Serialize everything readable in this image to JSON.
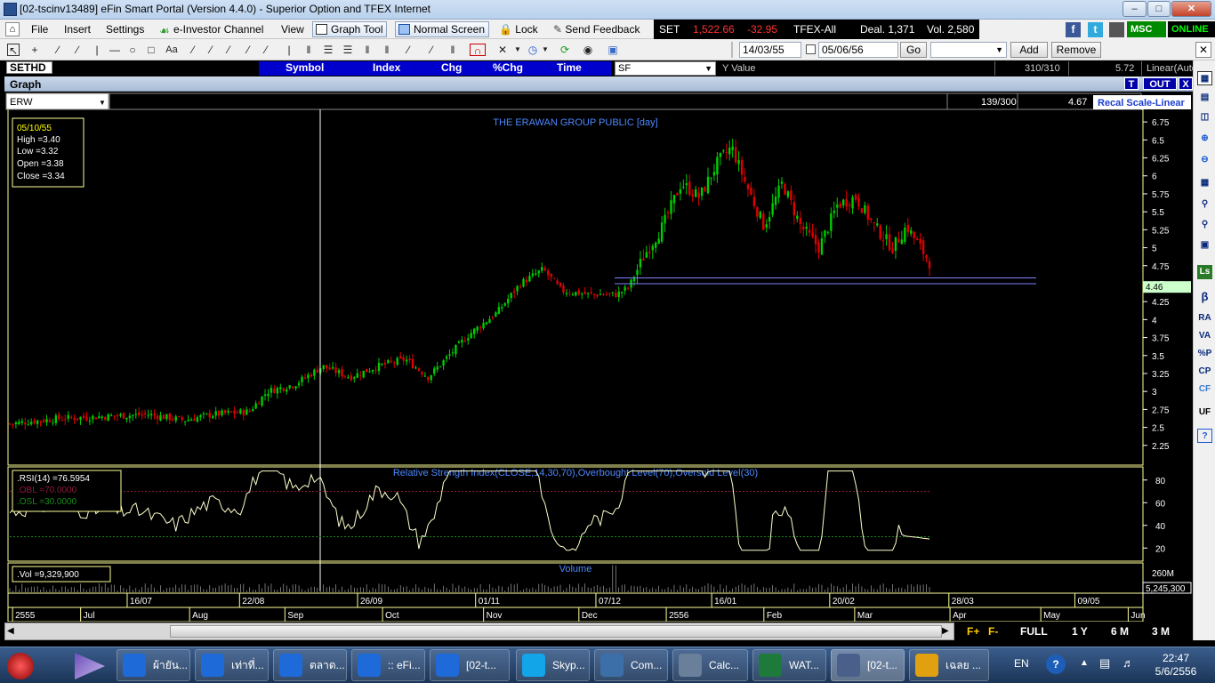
{
  "window": {
    "title": "[02-tscinv13489] eFin Smart Portal (Version 4.4.0) - Superior Option and TFEX Internet"
  },
  "menu": {
    "items": [
      "File",
      "Insert",
      "Settings",
      "View"
    ],
    "einvestor": "e-Investor Channel",
    "graph_tool": "Graph Tool",
    "normal_screen": "Normal Screen",
    "lock": "Lock",
    "send_feedback": "Send Feedback"
  },
  "ticker": {
    "market": "SET",
    "index": "1,522.66",
    "change": "-32.95",
    "tfex": "TFEX-All",
    "deal": "Deal. 1,371",
    "vol": "Vol. 2,580"
  },
  "brand": {
    "msc": "MSC",
    "status": "ONLINE"
  },
  "toolbar2": {
    "date_from": "14/03/55",
    "date_to": "05/06/56",
    "go": "Go",
    "add": "Add",
    "remove": "Remove",
    "text_tool": "Aa"
  },
  "row3": {
    "market_select": "SETHD",
    "columns": [
      "Symbol",
      "Index",
      "Chg",
      "%Chg",
      "Time"
    ],
    "sf_select": "SF",
    "y_value_label": "Y Value",
    "bars": "310/310",
    "y_value": "5.72",
    "scale": "Linear(Auto"
  },
  "graph": {
    "header": "Graph",
    "t_btn": "T",
    "out_btn": "OUT",
    "x_btn": "X",
    "symbol": "ERW",
    "bars_visible": "139/300",
    "cursor_value": "4.67",
    "recal": "Recal Scale-Linear",
    "last_price_tag": "4.46",
    "ohlc": {
      "date": "05/10/55",
      "high": "High  =3.40",
      "low": "Low   =3.32",
      "open": "Open  =3.38",
      "close": "Close  =3.34"
    },
    "rsi_legend": {
      "rsi": ".RSI(14)    =76.5954",
      "obl": ".OBL    =70.0000",
      "osl": ".OSL    =30.0000"
    },
    "vol_legend": ".Vol    =9,329,900",
    "volume_extra": "5,245,300",
    "timeline_row1": [
      {
        "t": "16/07",
        "x": 0.105
      },
      {
        "t": "22/08",
        "x": 0.204
      },
      {
        "t": "26/09",
        "x": 0.308
      },
      {
        "t": "01/11",
        "x": 0.412
      },
      {
        "t": "07/12",
        "x": 0.518
      },
      {
        "t": "16/01",
        "x": 0.62
      },
      {
        "t": "20/02",
        "x": 0.724
      },
      {
        "t": "28/03",
        "x": 0.829
      },
      {
        "t": "09/05",
        "x": 0.94
      }
    ],
    "timeline_row2": [
      {
        "t": "2555",
        "x": 0.004
      },
      {
        "t": "Jul",
        "x": 0.064
      },
      {
        "t": "Aug",
        "x": 0.16
      },
      {
        "t": "Sep",
        "x": 0.244
      },
      {
        "t": "Oct",
        "x": 0.33
      },
      {
        "t": "Nov",
        "x": 0.419
      },
      {
        "t": "Dec",
        "x": 0.503
      },
      {
        "t": "2556",
        "x": 0.58
      },
      {
        "t": "Feb",
        "x": 0.666
      },
      {
        "t": "Mar",
        "x": 0.746
      },
      {
        "t": "Apr",
        "x": 0.83
      },
      {
        "t": "May",
        "x": 0.91
      },
      {
        "t": "Jun",
        "x": 0.987
      }
    ]
  },
  "chart_data": [
    {
      "type": "candlestick",
      "title": "THE ERAWAN GROUP PUBLIC [day]",
      "ylim": [
        2.0,
        6.9
      ],
      "yticks": [
        "2.25",
        "2.5",
        "2.75",
        "3",
        "3.25",
        "3.5",
        "3.75",
        "4",
        "4.25",
        "4.5",
        "4.75",
        "5",
        "5.25",
        "5.5",
        "5.75",
        "6",
        "6.25",
        "6.5",
        "6.75"
      ],
      "close_path": [
        [
          0,
          2.55
        ],
        [
          0.05,
          2.62
        ],
        [
          0.1,
          2.65
        ],
        [
          0.15,
          2.68
        ],
        [
          0.19,
          2.6
        ],
        [
          0.22,
          2.68
        ],
        [
          0.26,
          2.72
        ],
        [
          0.28,
          3.0
        ],
        [
          0.31,
          3.1
        ],
        [
          0.34,
          3.35
        ],
        [
          0.37,
          3.2
        ],
        [
          0.4,
          3.35
        ],
        [
          0.43,
          3.45
        ],
        [
          0.455,
          3.2
        ],
        [
          0.47,
          3.4
        ],
        [
          0.5,
          3.8
        ],
        [
          0.53,
          4.1
        ],
        [
          0.555,
          4.5
        ],
        [
          0.58,
          4.7
        ],
        [
          0.6,
          4.4
        ],
        [
          0.63,
          4.35
        ],
        [
          0.66,
          4.35
        ],
        [
          0.673,
          4.45
        ],
        [
          0.69,
          4.9
        ],
        [
          0.71,
          5.3
        ],
        [
          0.73,
          5.9
        ],
        [
          0.75,
          5.7
        ],
        [
          0.77,
          6.2
        ],
        [
          0.785,
          6.4
        ],
        [
          0.8,
          5.9
        ],
        [
          0.82,
          5.3
        ],
        [
          0.84,
          5.9
        ],
        [
          0.86,
          5.3
        ],
        [
          0.88,
          5.0
        ],
        [
          0.9,
          5.6
        ],
        [
          0.92,
          5.7
        ],
        [
          0.94,
          5.3
        ],
        [
          0.96,
          5.0
        ],
        [
          0.975,
          5.3
        ],
        [
          0.99,
          5.0
        ],
        [
          1.0,
          4.8
        ]
      ],
      "trend_lines": [
        4.58,
        4.5
      ],
      "last_price": 4.46
    },
    {
      "type": "line",
      "title": "Relative Strength Index(CLOSE,14,30,70),Overbought Level(70),Oversold Level(30)",
      "ylim": [
        10,
        90
      ],
      "yticks": [
        "20",
        "40",
        "60",
        "80"
      ],
      "overbought": 70,
      "oversold": 30,
      "current": 76.5954
    },
    {
      "type": "bar",
      "title": "Volume",
      "yticks": [
        "260M"
      ]
    }
  ],
  "zoom": {
    "buttons": [
      "FULL",
      "1 Y",
      "6 M",
      "3 M"
    ]
  },
  "taskbar": {
    "tasks": [
      "ผ้ายัน...",
      "เท่าที่...",
      "ตลาด...",
      ":: eFi...",
      "[02-t...",
      "Skyp...",
      "Com...",
      "Calc...",
      "WAT...",
      "[02-t...",
      "เฉลย ..."
    ],
    "lang": "EN",
    "time": "22:47",
    "date": "5/6/2556"
  },
  "colors": {
    "up": "#00cc00",
    "down": "#e00000",
    "axis": "#ffffff",
    "panel_border": "#ffff99",
    "title_blue": "#4d88ff",
    "rsi_line": "#ffffcc"
  }
}
